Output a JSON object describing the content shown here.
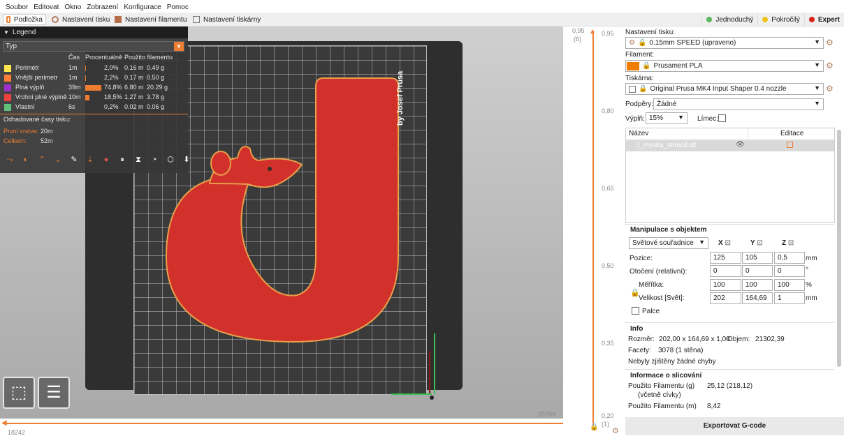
{
  "menu": [
    "Soubor",
    "Editovat",
    "Okno",
    "Zobrazení",
    "Konfigurace",
    "Pomoc"
  ],
  "tabs": [
    {
      "label": "Podložka",
      "icon": "bed-icon"
    },
    {
      "label": "Nastavení tisku",
      "icon": "print-settings-icon"
    },
    {
      "label": "Nastavení filamentu",
      "icon": "filament-icon"
    },
    {
      "label": "Nastavení tiskárny",
      "icon": "printer-icon"
    }
  ],
  "modes": [
    {
      "label": "Jednoduchý",
      "color": "#5cb85c"
    },
    {
      "label": "Pokročilý",
      "color": "#f0c419"
    },
    {
      "label": "Expert",
      "color": "#d9241e"
    }
  ],
  "legend": {
    "title": "Legend",
    "selector": "Typ",
    "headers": {
      "time": "Čas",
      "percent": "Procentuálně",
      "used": "Použito filamentu"
    },
    "rows": [
      {
        "name": "Perimetr",
        "color": "#ffe64d",
        "time": "1m",
        "pct": "2,0%",
        "m": "0.16 m",
        "g": "0.49 g",
        "fraction": 0.02
      },
      {
        "name": "Vnější perimetr",
        "color": "#ff7d38",
        "time": "1m",
        "pct": "2,2%",
        "m": "0.17 m",
        "g": "0.50 g",
        "fraction": 0.022
      },
      {
        "name": "Plná výplň",
        "color": "#9e33cc",
        "time": "39m",
        "pct": "74,8%",
        "m": "6.80 m",
        "g": "20.29 g",
        "fraction": 0.748
      },
      {
        "name": "Vrchní plné výplně",
        "color": "#f04040",
        "time": "10m",
        "pct": "18,5%",
        "m": "1.27 m",
        "g": "3.78 g",
        "fraction": 0.185
      },
      {
        "name": "Vlastní",
        "color": "#5ec07b",
        "time": "6s",
        "pct": "0,2%",
        "m": "0.02 m",
        "g": "0.06 g",
        "fraction": 0.002
      }
    ],
    "est_title": "Odhadované časy tisku:",
    "first_layer_label": "První vrstva:",
    "first_layer": "20m",
    "total_label": "Celkem:",
    "total": "52m"
  },
  "model_text": "by Josef Prusa",
  "hslider": {
    "left": "18242",
    "right": "23789"
  },
  "vslider": {
    "top": "0,95",
    "top_sub": "(6)",
    "bottom": "0,20",
    "bottom_sub": "(1)",
    "ticks": [
      "0,95",
      "0,80",
      "0,65",
      "0,50",
      "0,35",
      "0,20"
    ]
  },
  "panel": {
    "print_label": "Nastavení tisku:",
    "print_value": "0.15mm SPEED (upraveno)",
    "filament_label": "Filament:",
    "filament_value": "Prusament PLA",
    "filament_color": "#f07d00",
    "printer_label": "Tiskárna:",
    "printer_value": "Original Prusa MK4 Input Shaper 0.4 nozzle",
    "supports_label": "Podpěry:",
    "supports_value": "Žádné",
    "infill_label": "Výplň:",
    "infill_value": "15%",
    "brim_label": "Límec:",
    "list_col_name": "Název",
    "list_col_edit": "Editace",
    "object_name": "J_myska_stencil.stl",
    "manip_title": "Manipulace s objektem",
    "coord_system": "Světové souřadnice",
    "axes": [
      "X",
      "Y",
      "Z"
    ],
    "position_label": "Pozice:",
    "position": [
      "125",
      "105",
      "0,5"
    ],
    "position_unit": "mm",
    "rotation_label": "Otočení (relativní):",
    "rotation": [
      "0",
      "0",
      "0"
    ],
    "rotation_unit": "°",
    "scale_label": "Měřítka:",
    "scale": [
      "100",
      "100",
      "100"
    ],
    "scale_unit": "%",
    "size_label": "Velikost [Svět]:",
    "size": [
      "202",
      "164,69",
      "1"
    ],
    "size_unit": "mm",
    "inches_label": "Palce",
    "info_title": "Info",
    "size_info_label": "Rozměr:",
    "size_info": "202,00 x 164,69 x 1,00",
    "volume_label": "Objem:",
    "volume": "21302,39",
    "facets_label": "Facety:",
    "facets": "3078 (1 stěna)",
    "errors": "Nebyly zjištěny žádné chyby",
    "slice_title": "Informace o slicování",
    "fil_g_label": "Použito Filamentu (g)",
    "fil_g_sub": "(včetně cívky)",
    "fil_g": "25,12 (218,12)",
    "fil_m_label": "Použito Filamentu (m)",
    "fil_m": "8,42",
    "export": "Exportovat G-code"
  }
}
